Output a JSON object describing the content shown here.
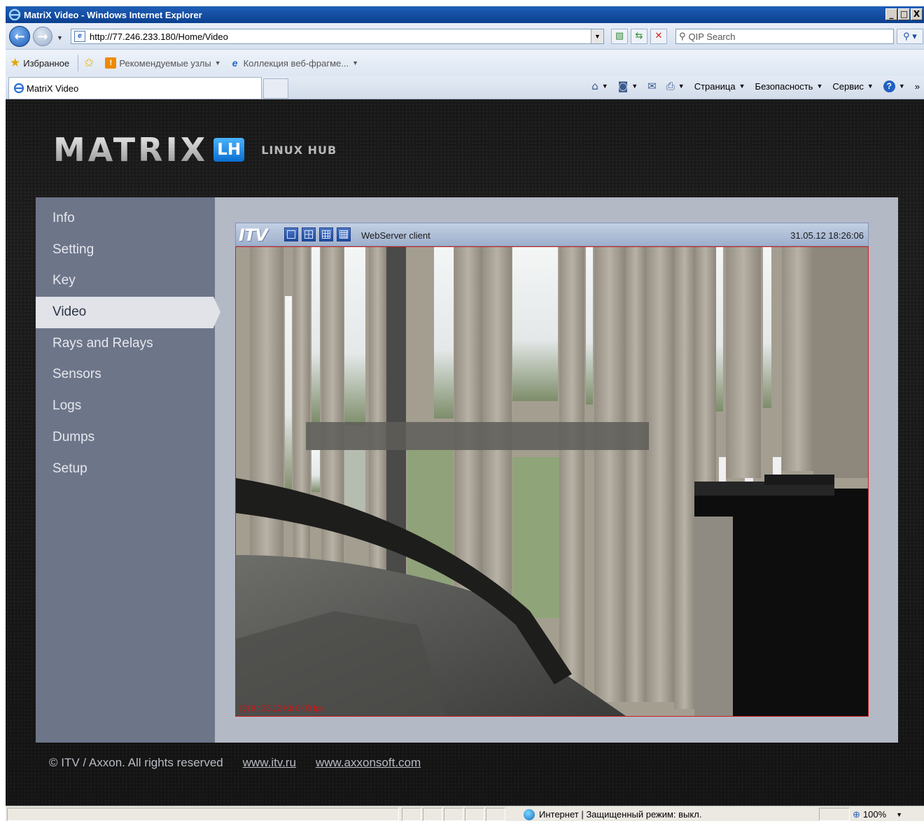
{
  "window": {
    "title": "MatriX Video - Windows Internet Explorer",
    "minimize": "_",
    "maximize": "□",
    "close": "X"
  },
  "addressbar": {
    "url": "http://77.246.233.180/Home/Video",
    "search_placeholder": "QIP Search"
  },
  "favorites": {
    "favorites_label": "Избранное",
    "recommended_label": "Рекомендуемые узлы",
    "gallery_label": "Коллекция веб-фрагме..."
  },
  "tabs": [
    {
      "label": "MatriX Video"
    }
  ],
  "commandbar": {
    "page_label": "Страница",
    "safety_label": "Безопасность",
    "tools_label": "Сервис",
    "overflow": "»"
  },
  "logo": {
    "word": "MATRIX",
    "badge": "LH",
    "subtitle": "LINUX HUB"
  },
  "sidebar": {
    "items": [
      {
        "label": "Info",
        "active": false
      },
      {
        "label": "Setting",
        "active": false
      },
      {
        "label": "Key",
        "active": false
      },
      {
        "label": "Video",
        "active": true
      },
      {
        "label": "Rays and Relays",
        "active": false
      },
      {
        "label": "Sensors",
        "active": false
      },
      {
        "label": "Logs",
        "active": false
      },
      {
        "label": "Dumps",
        "active": false
      },
      {
        "label": "Setup",
        "active": false
      }
    ]
  },
  "viewer": {
    "brand": "ITV",
    "title": "WebServer client",
    "datetime": "31.05.12 18:26:06",
    "status_overlay": "[9] 9 : 25,12 Kb 0,00 fps"
  },
  "footer": {
    "copyright": "© ITV / Axxon. All rights reserved",
    "link1": "www.itv.ru",
    "link2": "www.axxonsoft.com"
  },
  "statusbar": {
    "zone": "Интернет | Защищенный режим: выкл.",
    "zoom": "100%"
  },
  "colors": {
    "sidebar_bg": "#6d7589",
    "content_bg": "#b4b9c6",
    "active_item_bg": "#e1e3e8",
    "video_border": "#cc2020",
    "page_bg": "#1c1c1c"
  }
}
